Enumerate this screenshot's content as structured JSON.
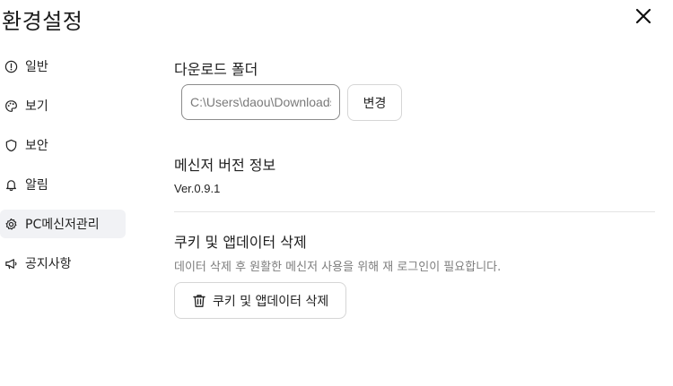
{
  "dialog": {
    "title": "환경설정",
    "close_icon": "close-icon"
  },
  "sidebar": {
    "items": [
      {
        "label": "일반",
        "icon": "info-circle-icon"
      },
      {
        "label": "보기",
        "icon": "palette-icon"
      },
      {
        "label": "보안",
        "icon": "shield-icon"
      },
      {
        "label": "알림",
        "icon": "bell-icon"
      },
      {
        "label": "PC메신저관리",
        "icon": "gear-icon",
        "active": true
      },
      {
        "label": "공지사항",
        "icon": "megaphone-icon"
      }
    ]
  },
  "download": {
    "title": "다운로드 폴더",
    "path_value": "C:\\Users\\daou\\Downloads",
    "change_label": "변경"
  },
  "version": {
    "title": "메신저 버전 정보",
    "value": "Ver.0.9.1"
  },
  "cache": {
    "title": "쿠키 및 앱데이터 삭제",
    "description": "데이터 삭제 후 원활한 메신저 사용을 위해 재 로그인이 필요합니다.",
    "button_label": "쿠키 및 앱데이터 삭제",
    "button_icon": "trash-icon"
  }
}
